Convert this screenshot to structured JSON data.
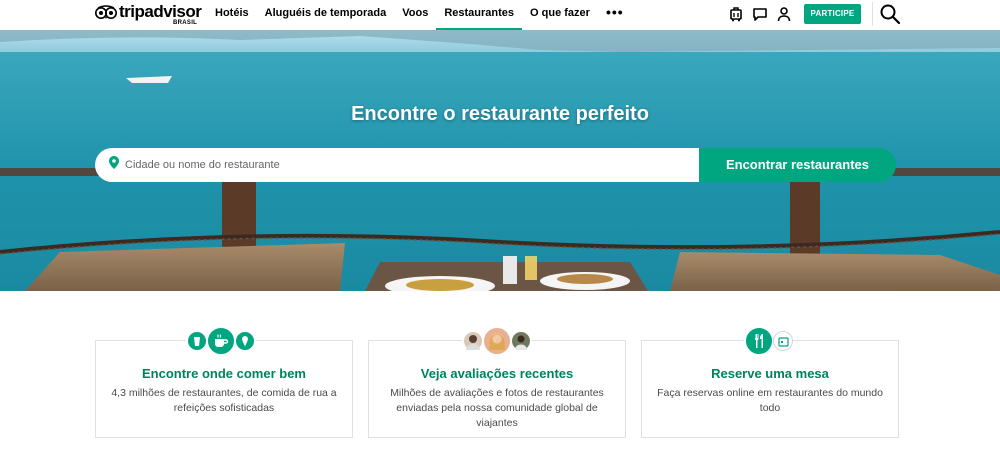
{
  "header": {
    "logo_text": "tripadvisor",
    "logo_sub": "BRASIL",
    "nav": [
      {
        "label": "Hotéis",
        "active": false
      },
      {
        "label": "Aluguéis de temporada",
        "active": false
      },
      {
        "label": "Voos",
        "active": false
      },
      {
        "label": "Restaurantes",
        "active": true
      },
      {
        "label": "O que fazer",
        "active": false
      }
    ],
    "more_label": "•••",
    "join_label": "PARTICIPE",
    "accent": "#00a680"
  },
  "hero": {
    "title": "Encontre o restaurante perfeito",
    "search_placeholder": "Cidade ou nome do restaurante",
    "search_button": "Encontrar restaurantes"
  },
  "cards": [
    {
      "title": "Encontre onde comer bem",
      "text": "4,3 milhões de restaurantes, de comida de rua a refeições sofisticadas"
    },
    {
      "title": "Veja avaliações recentes",
      "text": "Milhões de avaliações e fotos de restaurantes enviadas pela nossa comunidade global de viajantes"
    },
    {
      "title": "Reserve uma mesa",
      "text": "Faça reservas online em restaurantes do mundo todo"
    }
  ]
}
